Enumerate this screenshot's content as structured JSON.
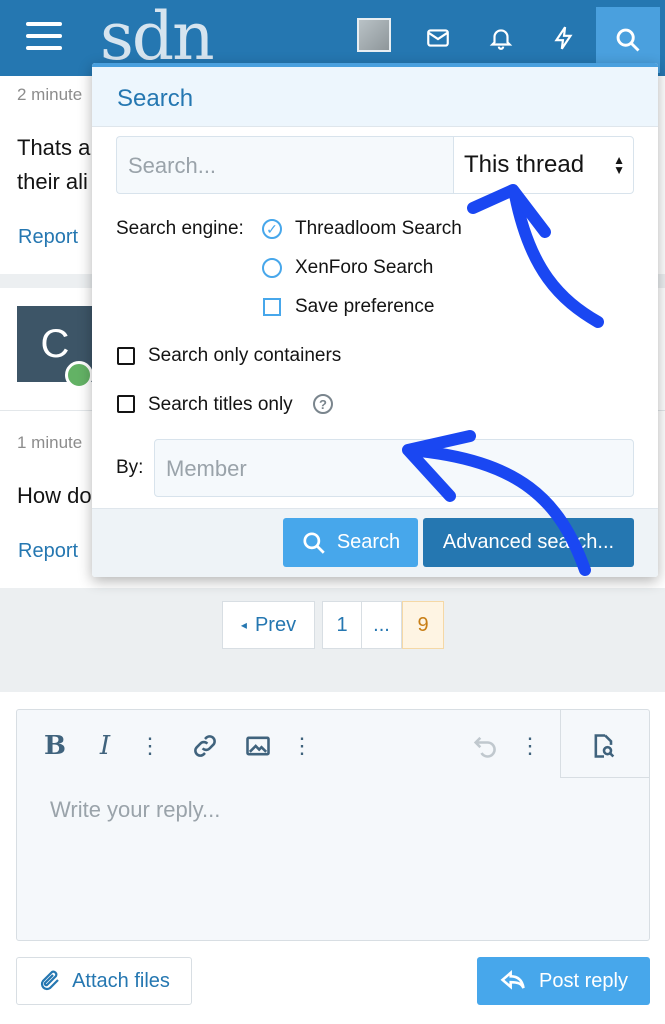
{
  "header": {
    "logo": "sdn",
    "icons": [
      "menu-icon",
      "avatar",
      "mail-icon",
      "bell-icon",
      "bolt-icon",
      "search-icon"
    ]
  },
  "posts": [
    {
      "time": "2 minute",
      "text_lines": [
        "Thats a",
        "their ali"
      ],
      "report": "Report"
    },
    {
      "avatar_letter": "C",
      "time": "1 minute",
      "text_lines": [
        "How do"
      ],
      "report": "Report"
    }
  ],
  "pagination": {
    "prev": "Prev",
    "pages": [
      "1",
      "...",
      "9"
    ],
    "current": "9"
  },
  "search_popup": {
    "title": "Search",
    "search_placeholder": "Search...",
    "scope_value": "This thread",
    "engine_label": "Search engine:",
    "engines": [
      "Threadloom Search",
      "XenForo Search"
    ],
    "selected_engine": "Threadloom Search",
    "save_preference": "Save preference",
    "only_containers": "Search only containers",
    "titles_only": "Search titles only",
    "by_label": "By:",
    "member_placeholder": "Member",
    "search_button": "Search",
    "advanced_button": "Advanced search..."
  },
  "editor": {
    "placeholder": "Write your reply...",
    "attach": "Attach files",
    "post_reply": "Post reply",
    "toolbar": [
      "bold-icon",
      "italic-icon",
      "more-icon",
      "link-icon",
      "image-icon",
      "more-icon",
      "undo-icon",
      "more-icon",
      "preview-icon"
    ]
  },
  "colors": {
    "header": "#2577b1",
    "accent": "#47a7eb",
    "annotation": "#1a47f2"
  }
}
